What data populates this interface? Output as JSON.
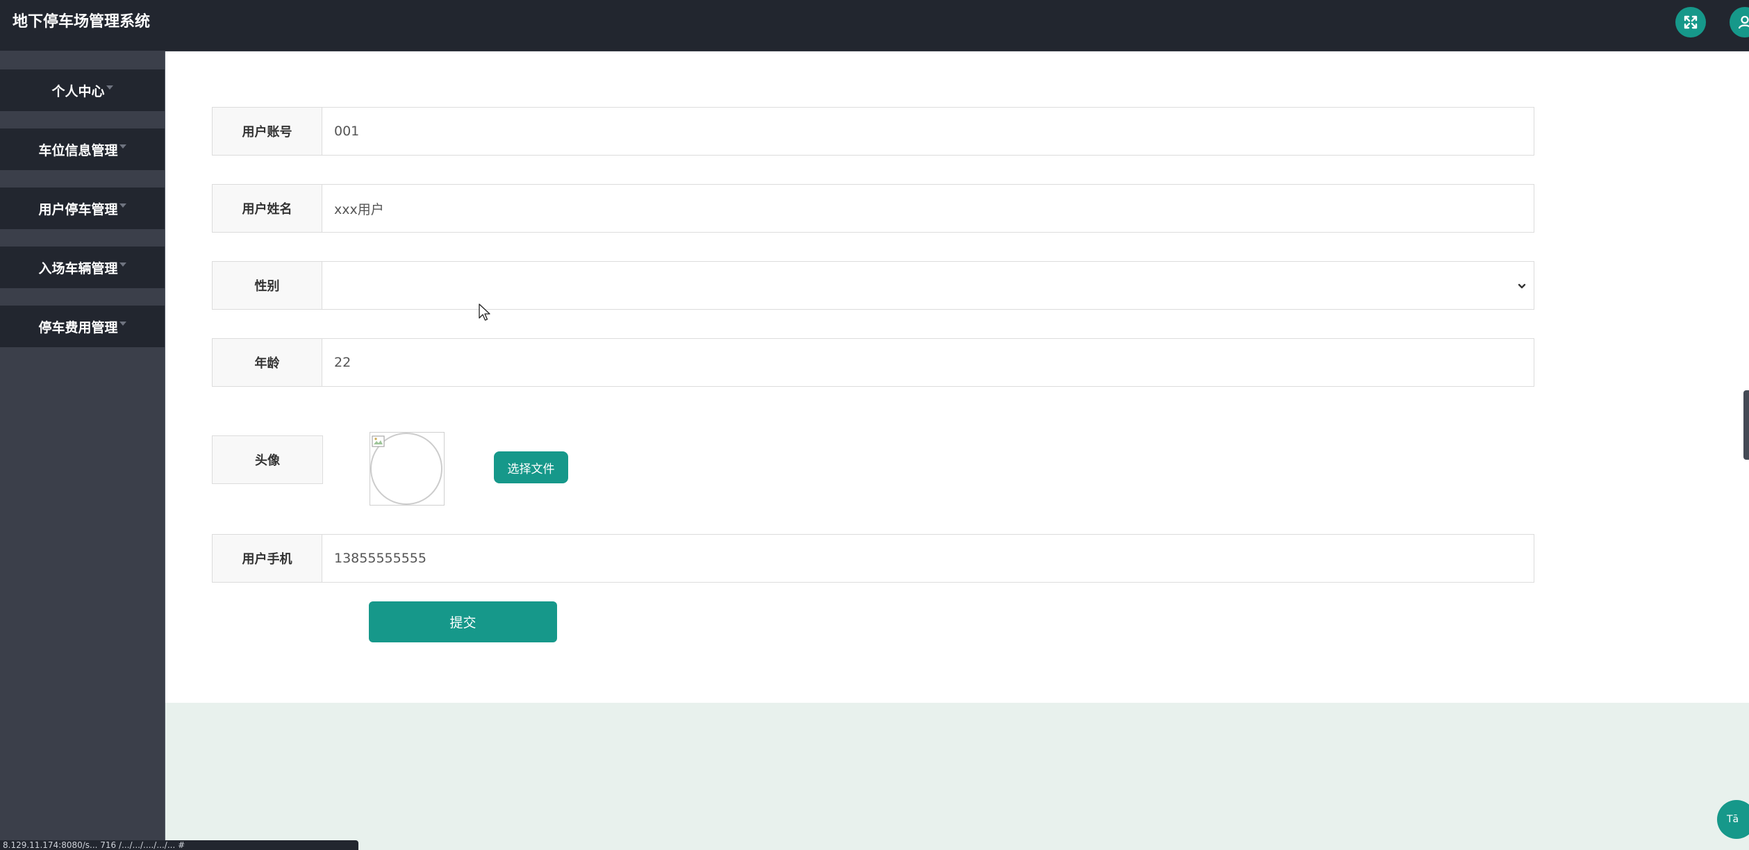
{
  "app": {
    "title": "地下停车场管理系统"
  },
  "sidebar": {
    "items": [
      {
        "label": "个人中心"
      },
      {
        "label": "车位信息管理"
      },
      {
        "label": "用户停车管理"
      },
      {
        "label": "入场车辆管理"
      },
      {
        "label": "停车费用管理"
      }
    ]
  },
  "form": {
    "account": {
      "label": "用户账号",
      "value": "001"
    },
    "name": {
      "label": "用户姓名",
      "value": "xxx用户"
    },
    "gender": {
      "label": "性别",
      "value": ""
    },
    "age": {
      "label": "年龄",
      "value": "22"
    },
    "avatar": {
      "label": "头像",
      "choose_file": "选择文件"
    },
    "phone": {
      "label": "用户手机",
      "value": "13855555555"
    },
    "submit": "提交"
  },
  "floating": {
    "translate_label": "Tā"
  },
  "status_bar": {
    "url": "8.129.11.174:8080/s... 716 /.../.../..../.../... #"
  },
  "colors": {
    "topbar": "#22262f",
    "sidebar": "#3b3f4a",
    "accent": "#16988a",
    "page_bg": "#e8f1ed"
  },
  "icons": {
    "expand": "expand-arrows-icon",
    "user": "user-icon",
    "select": "chevron-down-icon",
    "broken_image": "broken-image-icon",
    "cursor": "mouse-cursor-icon"
  }
}
